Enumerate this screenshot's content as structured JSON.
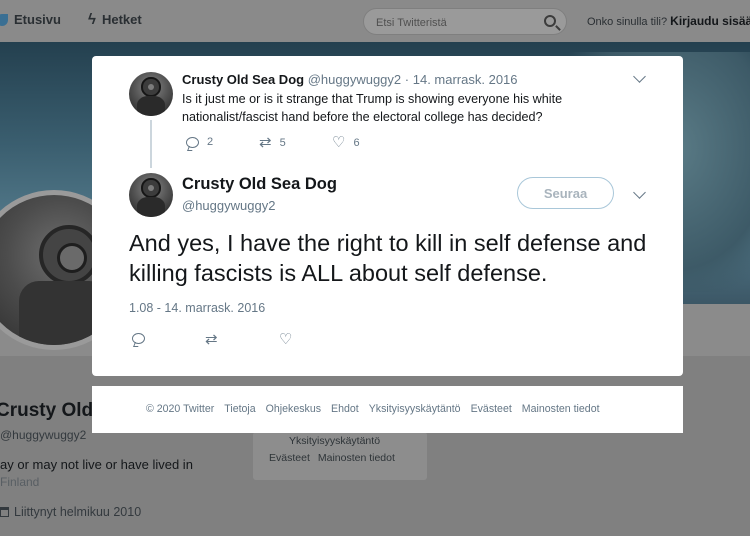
{
  "topnav": {
    "home_label": "Etusivu",
    "moments_label": "Hetket",
    "search_placeholder": "Etsi Twitteristä",
    "login_question": "Onko sinulla tili?",
    "login_link": "Kirjaudu sisää"
  },
  "profile": {
    "name": "Crusty Old",
    "handle": "@huggywuggy2",
    "bio": "ay or may not live or have lived in",
    "location": "Finland",
    "joined": "Liittynyt helmikuu 2010"
  },
  "bg_footer": {
    "privacy": "Yksityisyyskäytäntö",
    "cookies": "Evästeet",
    "ads_info": "Mainosten tiedot"
  },
  "tweet1": {
    "name": "Crusty Old Sea Dog",
    "handle": "@huggywuggy2",
    "separator": "·",
    "date": "14. marrask. 2016",
    "text": "Is it just me or is it strange that Trump is showing everyone his white nationalist/fascist hand before the electoral college has decided?",
    "replies": "2",
    "retweets": "5",
    "likes": "6"
  },
  "tweet2": {
    "name": "Crusty Old Sea Dog",
    "handle": "@huggywuggy2",
    "follow_label": "Seuraa",
    "text": "And yes, I have the right to kill in self defense and killing fascists is ALL about self defense.",
    "timestamp": "1.08 - 14. marrask. 2016"
  },
  "footer": {
    "links": [
      "© 2020 Twitter",
      "Tietoja",
      "Ohjekeskus",
      "Ehdot",
      "Yksityisyyskäytäntö",
      "Evästeet",
      "Mainosten tiedot"
    ]
  },
  "colors": {
    "accent": "#1da1f2",
    "secondary_text": "#657786",
    "overlay_bg": "#808080"
  }
}
